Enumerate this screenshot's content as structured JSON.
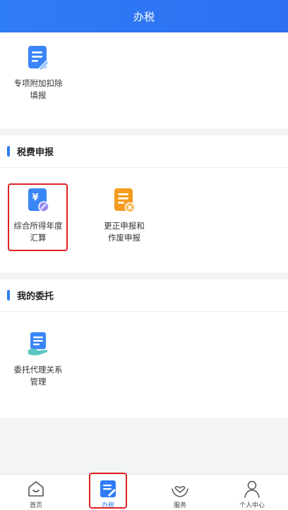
{
  "header": {
    "title": "办税"
  },
  "top_section": {
    "items": [
      {
        "label_line1": "专项附加扣除",
        "label_line2": "填报",
        "icon": "document-edit-icon"
      }
    ]
  },
  "tax_section": {
    "title": "税费申报",
    "items": [
      {
        "label_line1": "综合所得年度",
        "label_line2": "汇算",
        "icon": "yen-document-icon",
        "highlighted": true
      },
      {
        "label_line1": "更正申报和",
        "label_line2": "作废申报",
        "icon": "document-cancel-icon"
      }
    ]
  },
  "entrust_section": {
    "title": "我的委托",
    "items": [
      {
        "label_line1": "委托代理关系",
        "label_line2": "管理",
        "icon": "document-hand-icon"
      }
    ]
  },
  "tabbar": {
    "tabs": [
      {
        "label": "首页",
        "icon": "home-icon"
      },
      {
        "label": "办税",
        "icon": "tax-document-icon",
        "active": true
      },
      {
        "label": "服务",
        "icon": "heart-hands-icon"
      },
      {
        "label": "个人中心",
        "icon": "person-icon"
      }
    ]
  },
  "colors": {
    "primary": "#2f7df6",
    "orange": "#f59b1f",
    "highlight_border": "#e02020"
  }
}
